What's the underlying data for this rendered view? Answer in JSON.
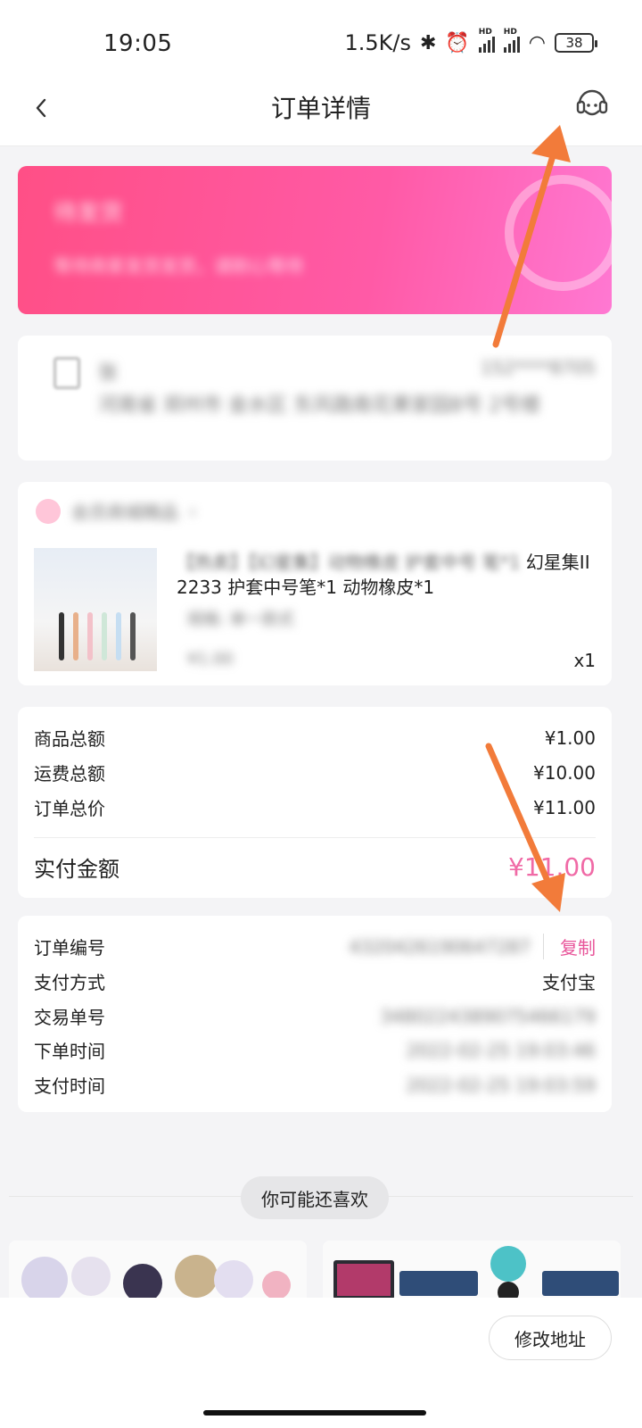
{
  "status_bar": {
    "time": "19:05",
    "net_speed": "1.5K/s",
    "battery": "38"
  },
  "header": {
    "back_icon": "chevron-left-icon",
    "title": "订单详情",
    "service_icon": "customer-service-icon"
  },
  "banner": {
    "status_text": "待发货",
    "subtitle": "等待商家发货发货，请耐心等待",
    "color": "#ff4f86"
  },
  "address": {
    "name": "张",
    "phone": "152****8705",
    "detail": "河南省 郑州市 金水区 东风路南花果家园8号 2号楼"
  },
  "goods": {
    "shop_name": "会员商城精品",
    "title_blurred": "【热卖】【幻星集】动物橡皮 护套中号 笔*1",
    "title_visible": "幻星集II 2233 护套中号笔*1 动物橡皮*1",
    "spec": "规格: 单一款式",
    "price": "¥1.00",
    "qty": "x1"
  },
  "summary": {
    "rows": [
      {
        "label": "商品总额",
        "value": "¥1.00"
      },
      {
        "label": "运费总额",
        "value": "¥10.00"
      },
      {
        "label": "订单总价",
        "value": "¥11.00"
      }
    ],
    "paid_label": "实付金额",
    "paid_value": "¥11.00",
    "accent": "#f06aa6"
  },
  "order_info": {
    "order_no_label": "订单编号",
    "order_no_value": "4320426190647287",
    "copy_label": "复制",
    "pay_method_label": "支付方式",
    "pay_method_value": "支付宝",
    "trade_no_label": "交易单号",
    "trade_no_value": "3480224389075466179",
    "order_time_label": "下单时间",
    "order_time_value": "2022-02-25 19:03:46",
    "pay_time_label": "支付时间",
    "pay_time_value": "2022-02-25 19:03:59"
  },
  "recommend": {
    "label": "你可能还喜欢"
  },
  "bottom": {
    "edit_address_label": "修改地址"
  }
}
